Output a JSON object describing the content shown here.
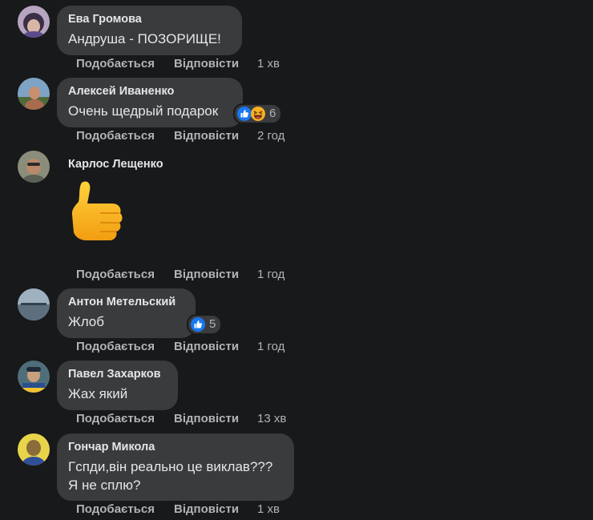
{
  "actions": {
    "like_label": "Подобається",
    "reply_label": "Відповісти"
  },
  "comments": [
    {
      "author": "Ева Громова",
      "text": "Андруша - ПОЗОРИЩЕ!",
      "time": "1 хв"
    },
    {
      "author": "Алексей Иваненко",
      "text": "Очень щедрый подарок",
      "time": "2 год",
      "reactions": [
        "like",
        "haha"
      ],
      "reaction_count": "6"
    },
    {
      "author": "Карлос Лещенко",
      "sticker": "thumbs-up-emoji",
      "time": "1 год"
    },
    {
      "author": "Антон Метельский",
      "text": "Жлоб",
      "time": "1 год",
      "reactions": [
        "like"
      ],
      "reaction_count": "5"
    },
    {
      "author": "Павел Захарков",
      "text": "Жах який",
      "time": "13 хв"
    },
    {
      "author": "Гончар Микола",
      "text": "Гспди,він реально це виклав???\nЯ не сплю?",
      "time": "1 хв"
    }
  ],
  "colors": {
    "background": "#18191a",
    "bubble": "#3a3b3c",
    "text": "#e4e6eb",
    "secondary_text": "#b0b3b8",
    "like_blue": "#1877f2"
  }
}
